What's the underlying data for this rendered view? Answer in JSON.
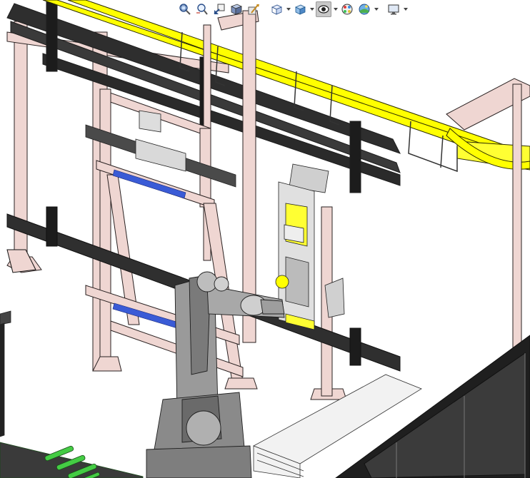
{
  "viewport": {
    "description_colors": {
      "frame": "#efd6d2",
      "frame_stroke": "#2a2222",
      "rail": "#2a2a2a",
      "conveyor_yellow": "#ffff00",
      "robot": "#8a8a8a",
      "blue_strip": "#3a5bd6",
      "green_rollers": "#44cc44",
      "fence": "#1a1a1a"
    }
  },
  "toolbar": {
    "buttons": [
      {
        "name": "zoom-to-fit-icon",
        "active": false,
        "dropdown": false
      },
      {
        "name": "zoom-to-area-icon",
        "active": false,
        "dropdown": false
      },
      {
        "name": "previous-view-icon",
        "active": false,
        "dropdown": false
      },
      {
        "name": "section-view-icon",
        "active": false,
        "dropdown": false
      },
      {
        "name": "dynamic-annotation-icon",
        "active": false,
        "dropdown": false
      },
      {
        "name": "view-orientation-icon",
        "active": false,
        "dropdown": true
      },
      {
        "name": "display-style-icon",
        "active": false,
        "dropdown": true
      },
      {
        "name": "hide-show-items-icon",
        "active": true,
        "dropdown": true
      },
      {
        "name": "edit-appearance-icon",
        "active": false,
        "dropdown": false
      },
      {
        "name": "apply-scene-icon",
        "active": false,
        "dropdown": true
      },
      {
        "name": "view-settings-icon",
        "active": false,
        "dropdown": true
      }
    ]
  }
}
